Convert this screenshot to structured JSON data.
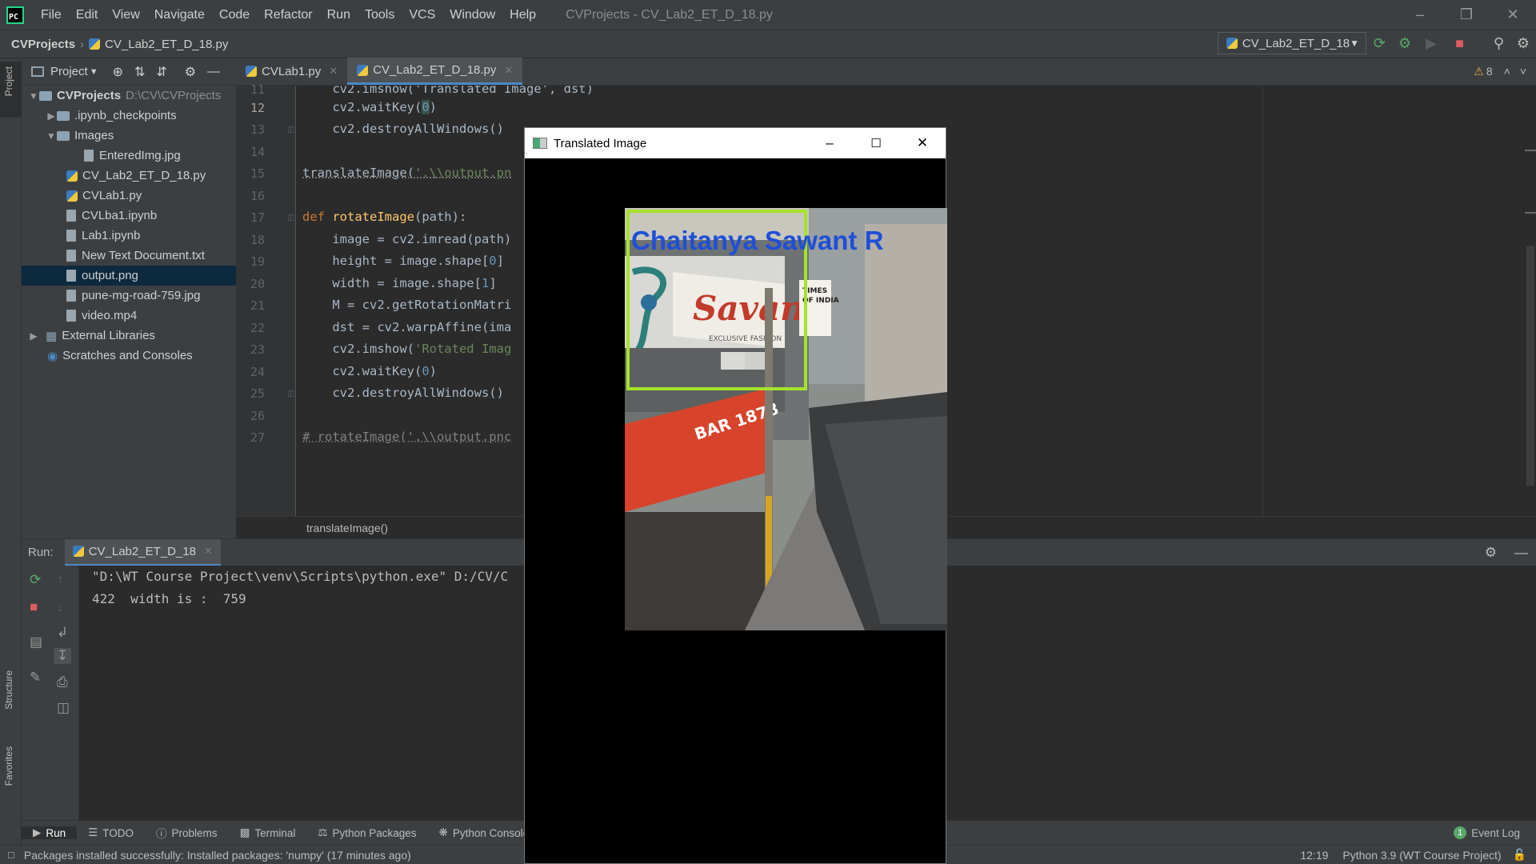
{
  "menu": {
    "items": [
      "File",
      "Edit",
      "View",
      "Navigate",
      "Code",
      "Refactor",
      "Run",
      "Tools",
      "VCS",
      "Window",
      "Help"
    ],
    "window_title": "CVProjects - CV_Lab2_ET_D_18.py"
  },
  "nav": {
    "project": "CVProjects",
    "file": "CV_Lab2_ET_D_18.py",
    "run_config": "CV_Lab2_ET_D_18"
  },
  "side": {
    "project_tab": "Project",
    "structure_tab": "Structure",
    "favorites_tab": "Favorites"
  },
  "project_panel": {
    "title": "Project",
    "tree": [
      {
        "label": "CVProjects",
        "suffix": "D:\\CV\\CVProjects",
        "type": "folder-root"
      },
      {
        "label": ".ipynb_checkpoints",
        "type": "folder"
      },
      {
        "label": "Images",
        "type": "folder"
      },
      {
        "label": "EnteredImg.jpg",
        "type": "file"
      },
      {
        "label": "CV_Lab2_ET_D_18.py",
        "type": "py"
      },
      {
        "label": "CVLab1.py",
        "type": "py"
      },
      {
        "label": "CVLba1.ipynb",
        "type": "file"
      },
      {
        "label": "Lab1.ipynb",
        "type": "file"
      },
      {
        "label": "New Text Document.txt",
        "type": "file"
      },
      {
        "label": "output.png",
        "type": "file"
      },
      {
        "label": "pune-mg-road-759.jpg",
        "type": "file"
      },
      {
        "label": "video.mp4",
        "type": "file"
      },
      {
        "label": "External Libraries",
        "type": "lib"
      },
      {
        "label": "Scratches and Consoles",
        "type": "scratch"
      }
    ]
  },
  "editor": {
    "tabs": [
      "CVLab1.py",
      "CV_Lab2_ET_D_18.py"
    ],
    "line_numbers": [
      "11",
      "12",
      "13",
      "14",
      "15",
      "16",
      "17",
      "18",
      "19",
      "20",
      "21",
      "22",
      "23",
      "24",
      "25",
      "26",
      "27"
    ],
    "lines": {
      "l11": "    cv2.imshow('Translated Image', dst)",
      "l12a": "    cv2.waitKey(",
      "l12b": "0",
      "l12c": ")",
      "l13": "    cv2.destroyAllWindows()",
      "l15a": "translateImage(",
      "l15b": "'.\\\\output.pn",
      "l17a": "def ",
      "l17b": "rotateImage",
      "l17c": "(path):",
      "l18": "    image = cv2.imread(path)",
      "l19a": "    height = image.shape[",
      "l19b": "0",
      "l19c": "]",
      "l20a": "    width = image.shape[",
      "l20b": "1",
      "l20c": "]",
      "l21": "    M = cv2.getRotationMatri",
      "l22": "    dst = cv2.warpAffine(ima",
      "l23a": "    cv2.imshow(",
      "l23b": "'Rotated Imag",
      "l24a": "    cv2.waitKey(",
      "l24b": "0",
      "l24c": ")",
      "l25": "    cv2.destroyAllWindows()",
      "l27": "# rotateImage('.\\\\output.pnc"
    },
    "warnings": "8",
    "breadcrumb": "translateImage()"
  },
  "run": {
    "label": "Run:",
    "tab": "CV_Lab2_ET_D_18",
    "output": [
      "\"D:\\WT Course Project\\venv\\Scripts\\python.exe\" D:/CV/C",
      "422  width is :  759"
    ]
  },
  "toolwindows": {
    "run": "Run",
    "todo": "TODO",
    "problems": "Problems",
    "terminal": "Terminal",
    "python_packages": "Python Packages",
    "python_console": "Python Console",
    "event_log": "Event Log",
    "event_count": "1"
  },
  "status": {
    "message": "Packages installed successfully: Installed packages: 'numpy' (17 minutes ago)",
    "position": "12:19",
    "interpreter": "Python 3.9 (WT Course Project)"
  },
  "cv_window": {
    "title": "Translated Image",
    "overlay_text": "Chaitanya  Sawant R",
    "sign_savana": "Savana",
    "sign_savana_sub": "EXCLUSIVE FASHION",
    "sign_bar": "BAR 1878",
    "sign_times_1": "TIMES",
    "sign_times_2": "OF INDIA"
  },
  "colors": {
    "accent": "#4a88c7",
    "box": "#a6e22e",
    "overlay_text": "#1e4fd8"
  }
}
